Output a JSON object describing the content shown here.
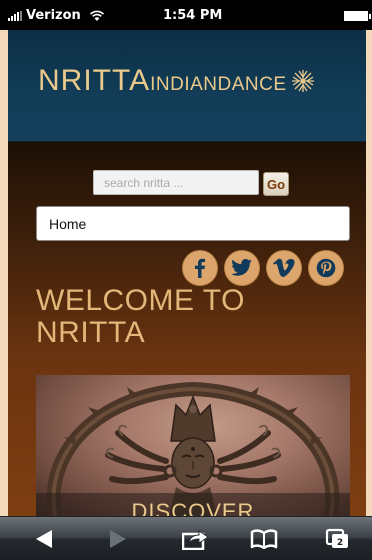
{
  "status_bar": {
    "carrier": "Verizon",
    "time": "1:54 PM",
    "icons": [
      "signal-icon",
      "wifi-icon",
      "battery-icon"
    ]
  },
  "site": {
    "logo": {
      "main": "NRITTA",
      "sub1": "INDIAN",
      "sub2": "DANCE",
      "icon": "star-icon"
    },
    "search": {
      "placeholder": "search nritta ...",
      "go_label": "Go"
    },
    "nav": {
      "selected": "Home"
    },
    "social": [
      "facebook-icon",
      "twitter-icon",
      "vimeo-icon",
      "pinterest-icon"
    ],
    "welcome_line1": "WELCOME TO",
    "welcome_line2": "NRITTA",
    "hero": {
      "caption": "DISCOVER"
    },
    "colors": {
      "accent": "#e3b67a",
      "header": "#123d58",
      "social_bg": "#dba56c"
    }
  },
  "toolbar": {
    "items": [
      "back-icon",
      "forward-icon",
      "share-icon",
      "bookmarks-icon",
      "tabs-icon"
    ],
    "tabs_count": "2"
  }
}
